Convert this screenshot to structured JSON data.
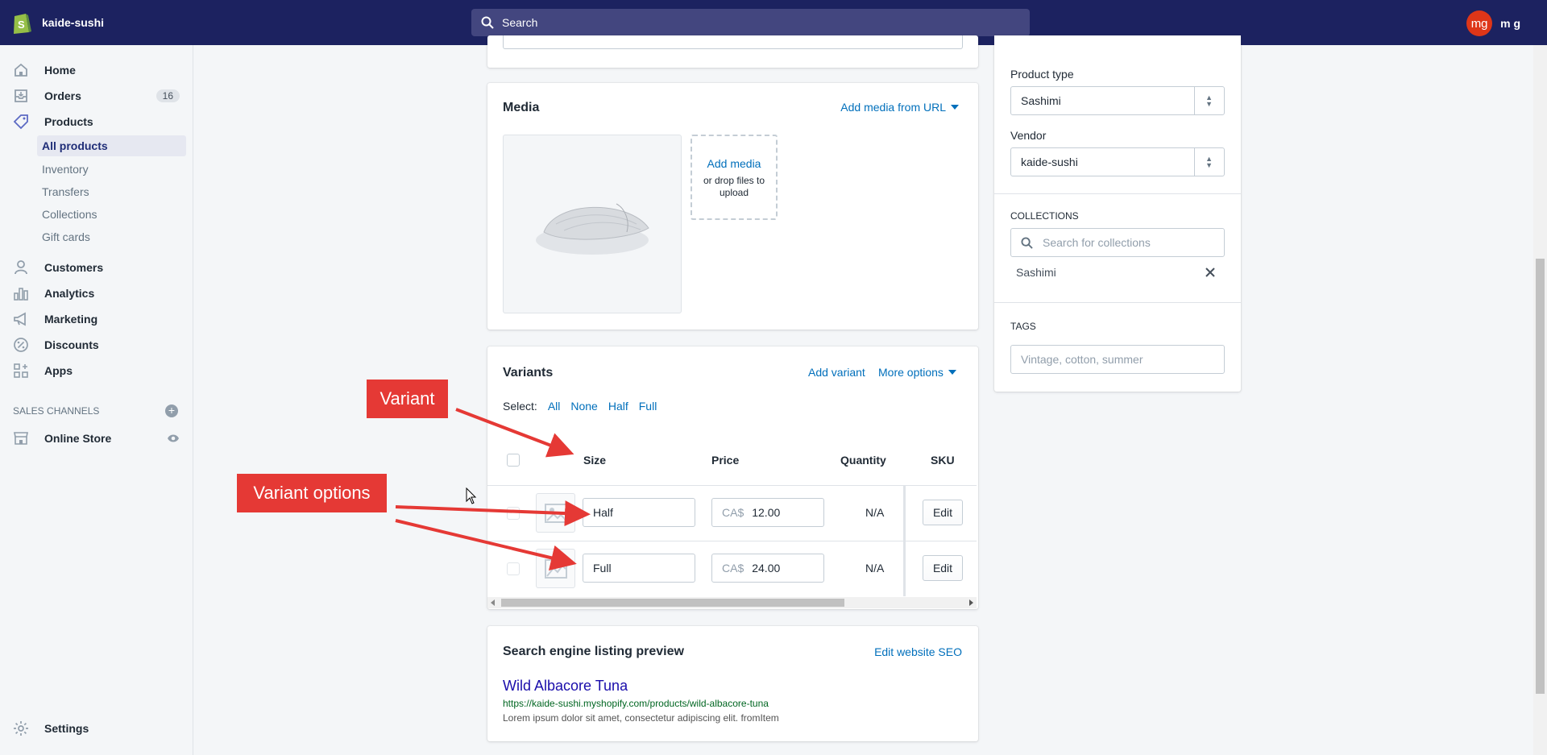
{
  "topbar": {
    "store_name": "kaide-sushi",
    "search_placeholder": "Search",
    "avatar_initials": "mg",
    "user_name": "m g"
  },
  "sidebar": {
    "items": [
      {
        "label": "Home",
        "icon": "home-icon"
      },
      {
        "label": "Orders",
        "icon": "orders-icon",
        "badge": "16"
      },
      {
        "label": "Products",
        "icon": "tag-icon"
      },
      {
        "label": "Customers",
        "icon": "person-icon"
      },
      {
        "label": "Analytics",
        "icon": "bar-chart-icon"
      },
      {
        "label": "Marketing",
        "icon": "megaphone-icon"
      },
      {
        "label": "Discounts",
        "icon": "discount-icon"
      },
      {
        "label": "Apps",
        "icon": "apps-icon"
      }
    ],
    "product_sub": [
      "All products",
      "Inventory",
      "Transfers",
      "Collections",
      "Gift cards"
    ],
    "sales_channels_heading": "SALES CHANNELS",
    "online_store": "Online Store",
    "settings": "Settings"
  },
  "media": {
    "title": "Media",
    "add_from_url": "Add media from URL",
    "add_media": "Add media",
    "drop_hint": "or drop files to upload"
  },
  "variants": {
    "title": "Variants",
    "add_variant": "Add variant",
    "more_options": "More options",
    "select_label": "Select:",
    "select_options": [
      "All",
      "None",
      "Half",
      "Full"
    ],
    "headers": {
      "size": "Size",
      "price": "Price",
      "quantity": "Quantity",
      "sku": "SKU"
    },
    "rows": [
      {
        "size": "Half",
        "currency": "CA$",
        "price": "12.00",
        "quantity": "N/A",
        "edit": "Edit"
      },
      {
        "size": "Full",
        "currency": "CA$",
        "price": "24.00",
        "quantity": "N/A",
        "edit": "Edit"
      }
    ]
  },
  "seo": {
    "title": "Search engine listing preview",
    "edit_link": "Edit website SEO",
    "page_title": "Wild Albacore Tuna",
    "url": "https://kaide-sushi.myshopify.com/products/wild-albacore-tuna",
    "description": "Lorem ipsum dolor sit amet, consectetur adipiscing elit. fromItem"
  },
  "organization": {
    "product_type_label": "Product type",
    "product_type_value": "Sashimi",
    "vendor_label": "Vendor",
    "vendor_value": "kaide-sushi",
    "collections_heading": "COLLECTIONS",
    "collections_placeholder": "Search for collections",
    "collection_tag": "Sashimi",
    "tags_heading": "TAGS",
    "tags_placeholder": "Vintage, cotton, summer"
  },
  "annotations": {
    "variant": "Variant",
    "variant_options": "Variant options"
  },
  "colors": {
    "topbar": "#1c2260",
    "link": "#006fbb",
    "annotation": "#e53935",
    "seo_title": "#1a0dab",
    "seo_url": "#006621"
  }
}
